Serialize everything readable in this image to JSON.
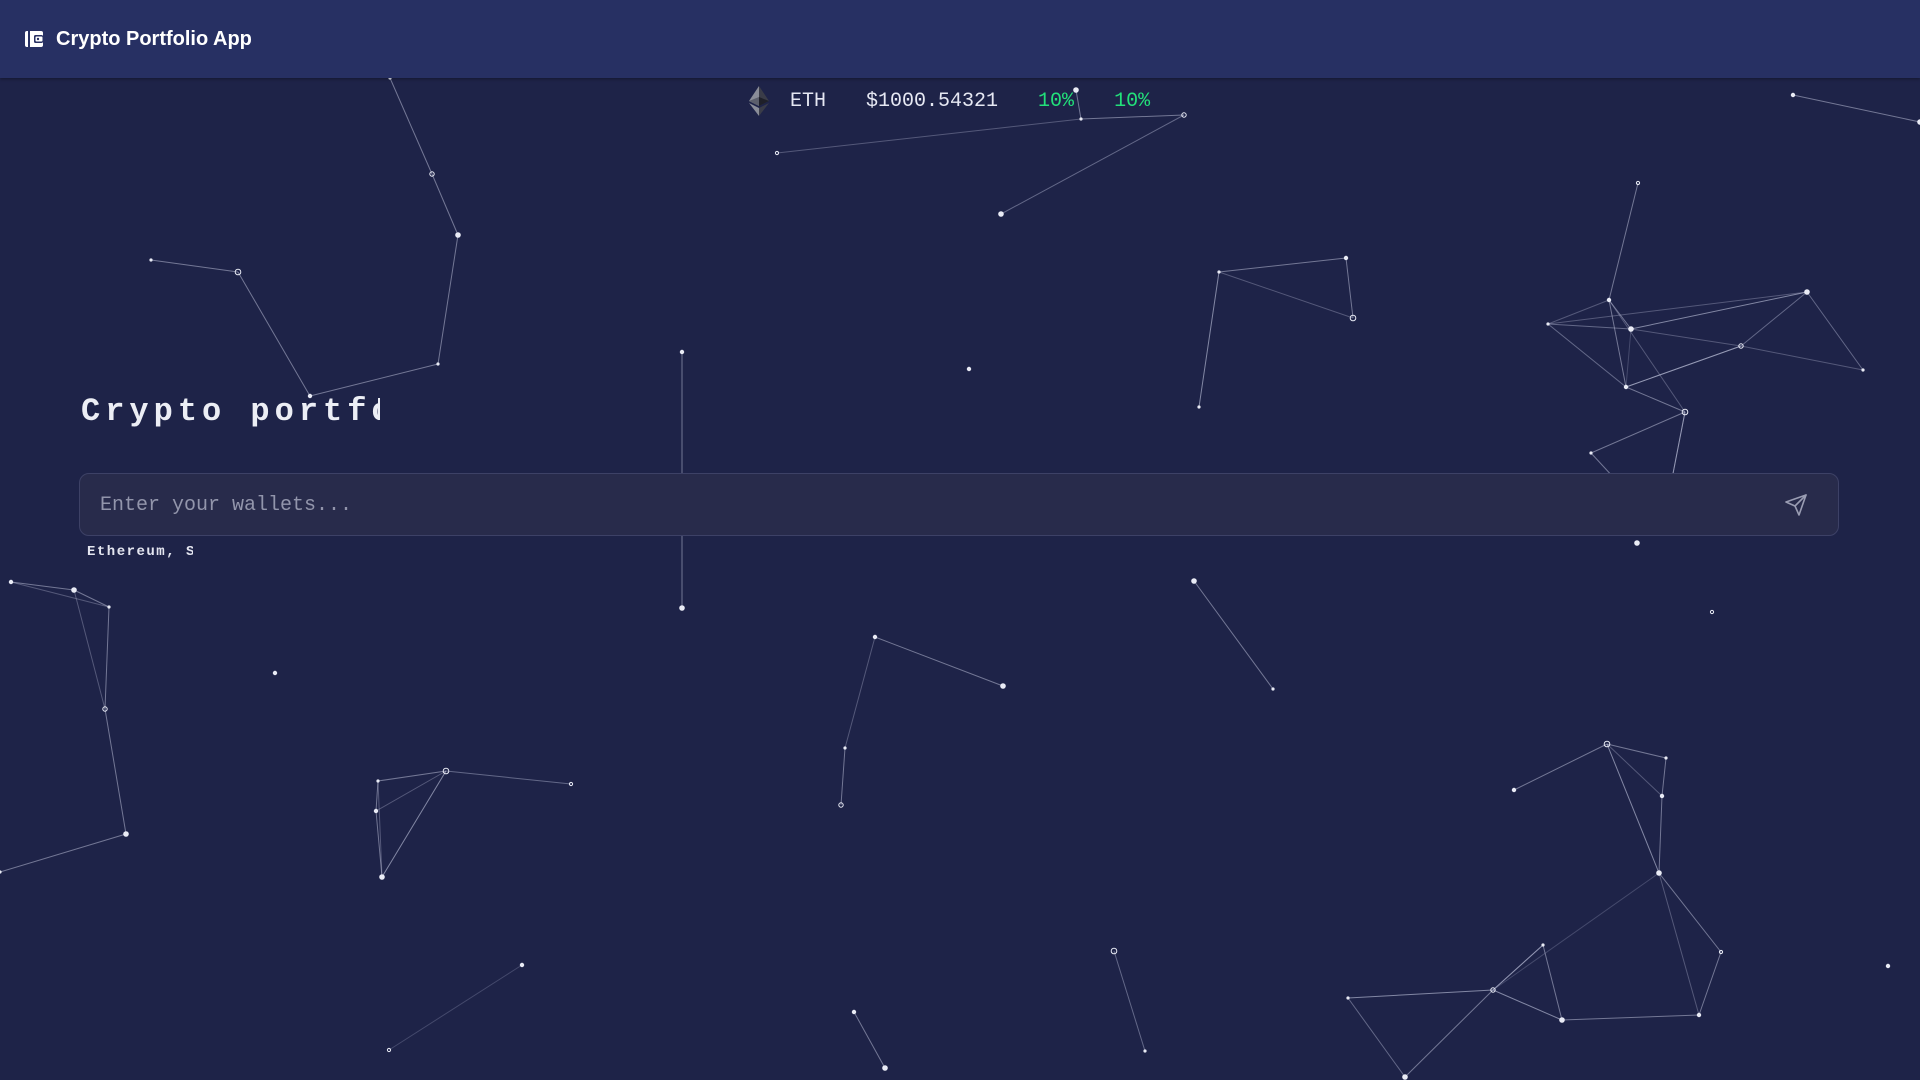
{
  "app": {
    "title": "Crypto Portfolio App",
    "icon": "wallet-icon"
  },
  "ticker": {
    "icon": "ethereum-icon",
    "symbol": "ETH",
    "price": "$1000.54321",
    "change_1": "10%",
    "change_2": "10%",
    "positive_color": "#22e07a"
  },
  "hero": {
    "headline": "Crypto portfolio"
  },
  "wallet_input": {
    "placeholder": "Enter your wallets...",
    "send_icon": "send-icon"
  },
  "hint": {
    "text": "Ethereum, Solana"
  },
  "colors": {
    "background": "#1e2348",
    "topbar": "#273063",
    "input_background": "#282b4b",
    "network_lines": "#b9bdd6"
  }
}
